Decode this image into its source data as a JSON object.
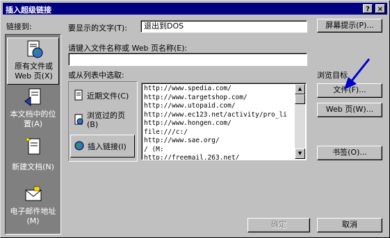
{
  "window": {
    "title": "插入超级链接",
    "help_glyph": "?",
    "close_glyph": "×"
  },
  "sidebar": {
    "heading": "链接到:",
    "items": [
      {
        "label": "原有文件或 Web 页(X)",
        "icon": "globe-document-icon"
      },
      {
        "label": "本文档中的位置(A)",
        "icon": "document-anchor-icon"
      },
      {
        "label": "新建文档(N)",
        "icon": "new-document-icon"
      },
      {
        "label": "电子邮件地址(M)",
        "icon": "envelope-icon"
      }
    ]
  },
  "display_text": {
    "label": "要显示的文字(T):",
    "value": "退出到DOS",
    "screen_tip_button": "屏幕提示(P)..."
  },
  "address": {
    "label": "请键入文件名称或 Web 页名称(E):",
    "value": ""
  },
  "choose_list": {
    "label": "或从列表中选取:",
    "tabs": [
      {
        "label": "近期文件(C)",
        "icon": "recent-files-icon"
      },
      {
        "label": "浏览过的页(B)",
        "icon": "browsed-pages-icon"
      },
      {
        "label": "插入链接(I)",
        "icon": "inserted-links-icon"
      }
    ],
    "urls": [
      "http://www.spedia.com/",
      "http://www.targetshop.com/",
      "http://www.utopaid.com/",
      "http://www.ec123.net/activity/pro_li",
      "http://www.hongen.com/",
      "file:///c:/",
      "http://www.sae.org/",
      "/  (M:",
      "http://freemail.263.net/"
    ]
  },
  "browse": {
    "label": "浏览目标",
    "file_button": "文件(F)...",
    "web_button": "Web 页(W)...",
    "bookmark_button": "书签(O)..."
  },
  "footer": {
    "ok_button": "确定",
    "cancel_button": "取消"
  },
  "colors": {
    "titlebar": "#000080",
    "dialog_bg": "#c0c0c0",
    "sidebar_bg": "#808080",
    "arrow": "#0000cc"
  }
}
